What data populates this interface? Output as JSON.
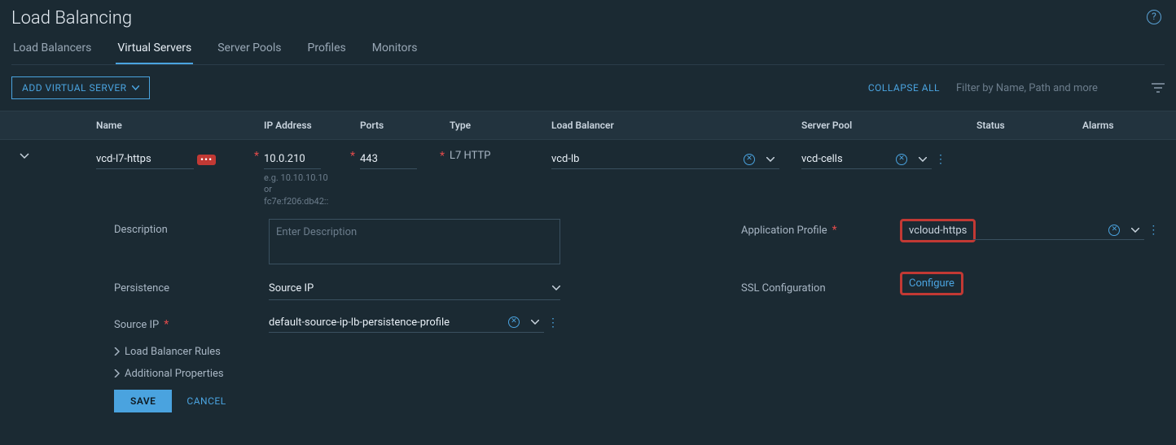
{
  "page": {
    "title": "Load Balancing"
  },
  "tabs": {
    "items": [
      "Load Balancers",
      "Virtual Servers",
      "Server Pools",
      "Profiles",
      "Monitors"
    ],
    "active": 1
  },
  "toolbar": {
    "add_button": "ADD VIRTUAL SERVER",
    "collapse_all": "COLLAPSE ALL",
    "filter_placeholder": "Filter by Name, Path and more"
  },
  "columns": {
    "name": "Name",
    "ip": "IP Address",
    "ports": "Ports",
    "type": "Type",
    "lb": "Load Balancer",
    "pool": "Server Pool",
    "status": "Status",
    "alarms": "Alarms"
  },
  "row": {
    "name": "vcd-l7-https",
    "ip": "10.0.210",
    "ip_hint": "e.g. 10.10.10.10 or fc7e:f206:db42::",
    "ports": "443",
    "type": "L7 HTTP",
    "lb": "vcd-lb",
    "pool": "vcd-cells"
  },
  "details": {
    "description_label": "Description",
    "description_placeholder": "Enter Description",
    "persistence_label": "Persistence",
    "persistence_value": "Source IP",
    "source_ip_label": "Source IP",
    "source_ip_value": "default-source-ip-lb-persistence-profile",
    "app_profile_label": "Application Profile",
    "app_profile_value": "vcloud-https",
    "ssl_label": "SSL Configuration",
    "ssl_link": "Configure",
    "lb_rules": "Load Balancer Rules",
    "add_props": "Additional Properties"
  },
  "actions": {
    "save": "SAVE",
    "cancel": "CANCEL"
  }
}
